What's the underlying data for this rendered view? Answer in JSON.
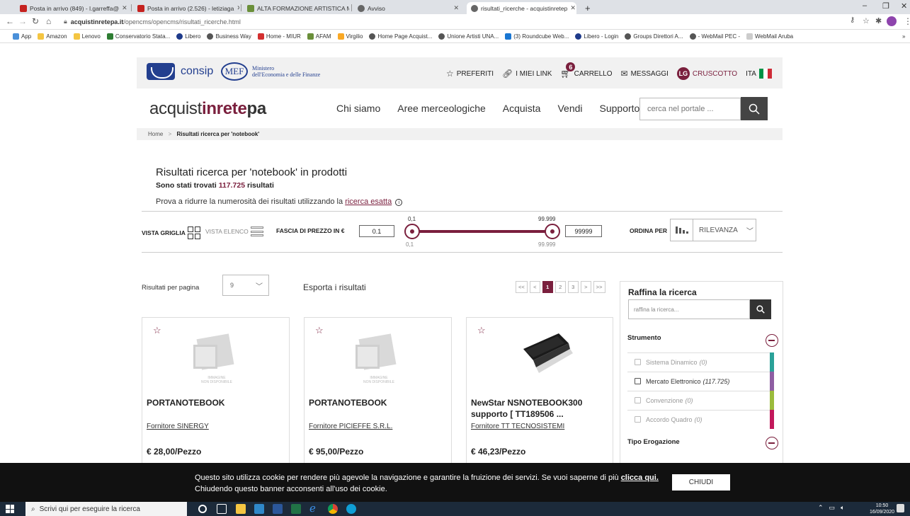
{
  "browser": {
    "tabs": [
      {
        "label": "Posta in arrivo (849) - l.garreffa@"
      },
      {
        "label": "Posta in arrivo (2.526) - letiziaga"
      },
      {
        "label": "ALTA FORMAZIONE ARTISTICA M"
      },
      {
        "label": "Avviso"
      },
      {
        "label": "risultati_ricerche - acquistinretep"
      }
    ],
    "new_tab": "+",
    "url_host": "acquistinretepa.it",
    "url_path": "/opencms/opencms/risultati_ricerche.html",
    "bookmarks": [
      "App",
      "Amazon",
      "Lenovo",
      "Conservatorio Stata...",
      "Libero",
      "Business Way",
      "Home - MIUR",
      "AFAM",
      "Virgilio",
      "Home Page Acquist...",
      "Unione Artisti UNA...",
      "(3) Roundcube Web...",
      "Libero - Login",
      "Groups Direttori A...",
      "- WebMail PEC -",
      "WebMail Aruba"
    ],
    "bookmarks_more": "»"
  },
  "header": {
    "consip": "consip",
    "mef": "MEF",
    "mef_line1": "Ministero",
    "mef_line2": "dell'Economia e delle Finanze",
    "preferiti": "PREFERITI",
    "miei_link": "I MIEI LINK",
    "cart_count": "6",
    "carrello": "CARRELLO",
    "messaggi": "MESSAGGI",
    "user_initials": "LG",
    "cruscotto": "CRUSCOTTO",
    "lang": "ITA",
    "brand_a": "acquist",
    "brand_b": "inrete",
    "brand_c": "pa",
    "nav": [
      "Chi siamo",
      "Aree merceologiche",
      "Acquista",
      "Vendi",
      "Supporto"
    ],
    "search_placeholder": "cerca nel portale ..."
  },
  "breadcrumb": {
    "home": "Home",
    "sep": ">",
    "current": "Risultati ricerca per 'notebook'"
  },
  "results": {
    "title": "Risultati ricerca per 'notebook' in prodotti",
    "count_prefix": "Sono stati trovati",
    "count": "117.725",
    "count_suffix": "risultati",
    "hint_prefix": "Prova a ridurre la numerosità dei risultati utilizzando la",
    "hint_link": "ricerca esatta"
  },
  "toolbar": {
    "vista_griglia": "VISTA GRIGLIA",
    "vista_elenco": "VISTA ELENCO",
    "fascia": "FASCIA DI PREZZO IN €",
    "price_min": "0.1",
    "price_max": "99999",
    "range_min_label": "0,1",
    "range_max_label": "99.999",
    "ordina": "ORDINA PER",
    "sort_value": "RILEVANZA"
  },
  "listing": {
    "rpp_label": "Risultati per pagina",
    "rpp_value": "9",
    "esporta": "Esporta i risultati",
    "pager": [
      "<<",
      "<",
      "1",
      "2",
      "3",
      ">",
      ">>"
    ],
    "no_image_line1": "IMMAGINE",
    "no_image_line2": "NON DISPONIBILE",
    "products": [
      {
        "name": "PORTANOTEBOOK",
        "supplier": "Fornitore SINERGY",
        "price": "€ 28,00/Pezzo"
      },
      {
        "name": "PORTANOTEBOOK",
        "supplier": "Fornitore PICIEFFE S.R.L.",
        "price": "€ 95,00/Pezzo"
      },
      {
        "name": "NewStar NSNOTEBOOK300 supporto [ TT189506 ...",
        "supplier": "Fornitore TT TECNOSISTEMI",
        "price": "€ 46,23/Pezzo"
      }
    ]
  },
  "sidebar": {
    "title": "Raffina la ricerca",
    "placeholder": "raffina la ricerca...",
    "section1": "Strumento",
    "items": [
      {
        "label": "Sistema Dinamico",
        "count": "(0)",
        "color": "#2aa198"
      },
      {
        "label": "Mercato Elettronico",
        "count": "(117.725)",
        "color": "#8e5ea2"
      },
      {
        "label": "Convenzione",
        "count": "(0)",
        "color": "#9bbb3c"
      },
      {
        "label": "Accordo Quadro",
        "count": "(0)",
        "color": "#c2185b"
      }
    ],
    "section2": "Tipo Erogazione"
  },
  "cookie": {
    "text1": "Questo sito utilizza cookie per rendere più agevole la navigazione e garantire la fruizione dei servizi. Se vuoi saperne di più",
    "link": "clicca qui.",
    "text2": "Chiudendo questo banner acconsenti all'uso dei cookie.",
    "button": "CHIUDI"
  },
  "taskbar": {
    "search": "Scrivi qui per eseguire la ricerca",
    "time": "10:50",
    "date": "16/09/2020"
  },
  "colors": {
    "accent": "#7a1f3d",
    "consip_blue": "#233f8f"
  }
}
